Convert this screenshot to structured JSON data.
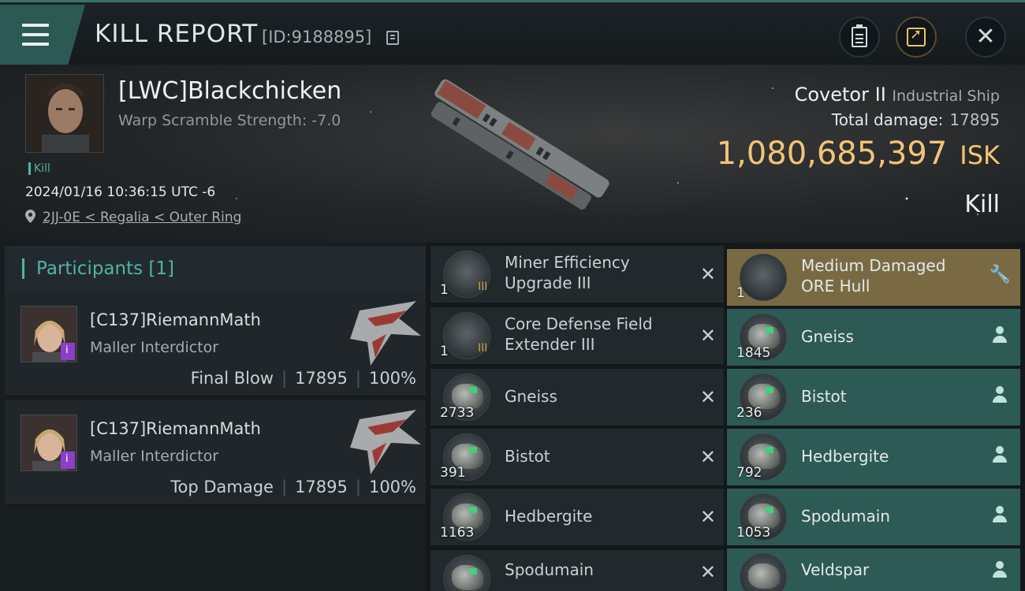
{
  "header": {
    "title": "KILL REPORT",
    "report_id": "[ID:9188895]",
    "icons": [
      "menu-icon",
      "copy-icon",
      "clipboard-icon",
      "share-icon",
      "close-icon"
    ]
  },
  "victim": {
    "name": "[LWC]Blackchicken",
    "warp_scramble": "Warp Scramble Strength: -7.0",
    "kill_tag": "Kill",
    "datetime": "2024/01/16 10:36:15 UTC -6",
    "location": "2JJ-0E < Regalia < Outer Ring"
  },
  "ship": {
    "name": "Covetor II",
    "class": "Industrial Ship",
    "total_damage_label": "Total damage:",
    "total_damage": "17895",
    "isk_value": "1,080,685,397",
    "isk_unit": "ISK",
    "outcome": "Kill"
  },
  "participants": {
    "title": "Participants",
    "count": "[1]",
    "entries": [
      {
        "name": "[C137]RiemannMath",
        "ship": "Maller Interdictor",
        "role": "Final Blow",
        "damage": "17895",
        "percent": "100%"
      },
      {
        "name": "[C137]RiemannMath",
        "ship": "Maller Interdictor",
        "role": "Top Damage",
        "damage": "17895",
        "percent": "100%"
      }
    ]
  },
  "items": {
    "destroyed": [
      {
        "line1": "Miner Efficiency",
        "line2": "Upgrade III",
        "qty": "1",
        "meta": "III"
      },
      {
        "line1": "Core Defense Field",
        "line2": "Extender III",
        "qty": "1",
        "meta": "III"
      },
      {
        "line1": "Gneiss",
        "line2": "",
        "qty": "2733"
      },
      {
        "line1": "Bistot",
        "line2": "",
        "qty": "391"
      },
      {
        "line1": "Hedbergite",
        "line2": "",
        "qty": "1163"
      },
      {
        "line1": "Spodumain",
        "line2": "",
        "qty": ""
      }
    ],
    "dropped": [
      {
        "line1": "Medium Damaged",
        "line2": "ORE Hull",
        "qty": "1"
      },
      {
        "line1": "Gneiss",
        "line2": "",
        "qty": "1845"
      },
      {
        "line1": "Bistot",
        "line2": "",
        "qty": "236"
      },
      {
        "line1": "Hedbergite",
        "line2": "",
        "qty": "792"
      },
      {
        "line1": "Spodumain",
        "line2": "",
        "qty": "1053"
      },
      {
        "line1": "Veldspar",
        "line2": "",
        "qty": ""
      }
    ]
  },
  "colors": {
    "accent_teal": "#4fb3a6",
    "isk_gold": "#f3c474",
    "dropped_bg": "#2e5a56",
    "damaged_bg": "#7a6a44"
  }
}
